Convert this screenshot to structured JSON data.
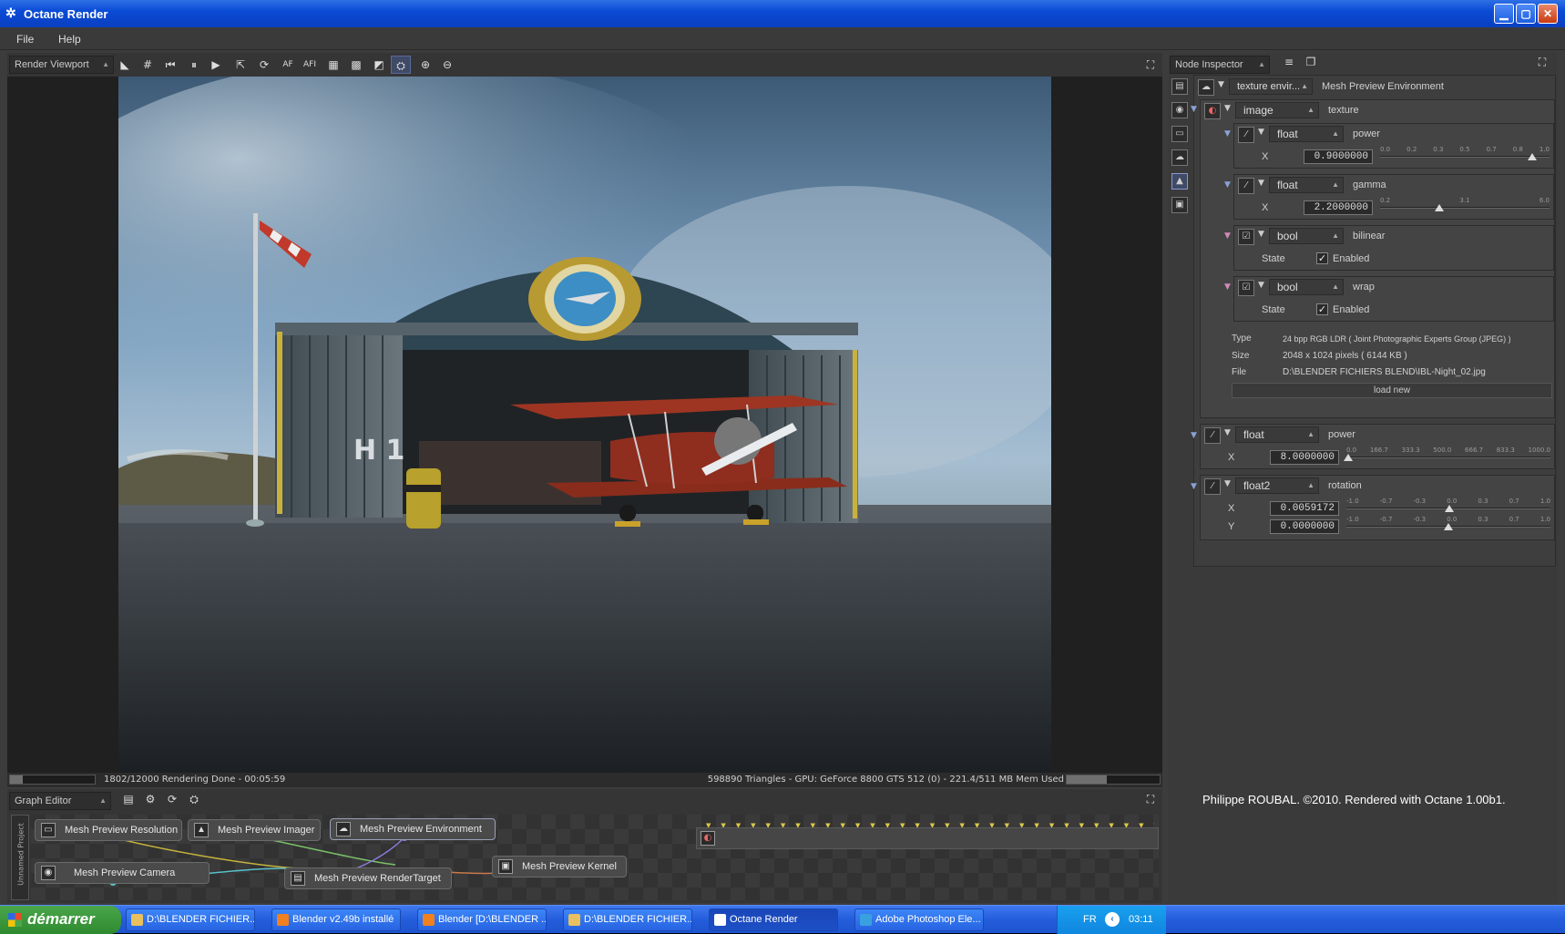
{
  "window": {
    "title": "Octane Render"
  },
  "menu": [
    "File",
    "Help"
  ],
  "viewport_toolbar": {
    "dropdown": "Render Viewport",
    "buttons": [
      {
        "name": "pick-focus-icon",
        "glyph": "◣"
      },
      {
        "name": "grid-icon",
        "glyph": "#"
      },
      {
        "name": "restart-icon",
        "glyph": "⏮"
      },
      {
        "name": "pause-icon",
        "glyph": "⏸"
      },
      {
        "name": "play-icon",
        "glyph": "▶"
      },
      {
        "name": "recenter-icon",
        "glyph": "⇱"
      },
      {
        "name": "reset-camera-icon",
        "glyph": "⟳"
      },
      {
        "name": "autofocus-icon",
        "glyph": "AF"
      },
      {
        "name": "autofocus-image-icon",
        "glyph": "AFI"
      },
      {
        "name": "region-icon",
        "glyph": "▦"
      },
      {
        "name": "checker-icon",
        "glyph": "▩"
      },
      {
        "name": "alpha-icon",
        "glyph": "◩"
      },
      {
        "name": "lock-view-icon",
        "glyph": "⛭"
      },
      {
        "name": "zoom-in-icon",
        "glyph": "⊕"
      },
      {
        "name": "zoom-out-icon",
        "glyph": "⊖"
      }
    ]
  },
  "status": {
    "left_text": "1802/12000 Rendering Done - 00:05:59",
    "right_text": "598890 Triangles - GPU: GeForce 8800 GTS 512 (0) - 221.4/511 MB Mem Used",
    "render_progress": 0.15,
    "memory_progress": 0.43
  },
  "render_image": {
    "sign_text": "H 1"
  },
  "graph_editor": {
    "dropdown": "Graph Editor",
    "side_label": "Unnamed Project",
    "nodes": [
      {
        "name": "graph-node-mesh-preview-resolution",
        "label": "Mesh Preview Resolution"
      },
      {
        "name": "graph-node-mesh-preview-imager",
        "label": "Mesh Preview Imager"
      },
      {
        "name": "graph-node-mesh-preview-environment",
        "label": "Mesh Preview Environment"
      },
      {
        "name": "graph-node-mesh-preview-camera",
        "label": "Mesh Preview Camera"
      },
      {
        "name": "graph-node-mesh-preview-rendertarget",
        "label": "Mesh Preview RenderTarget"
      },
      {
        "name": "graph-node-mesh-preview-kernel",
        "label": "Mesh Preview Kernel"
      }
    ]
  },
  "inspector": {
    "dropdown": "Node Inspector",
    "root": {
      "type": "texture envir...",
      "name": "Mesh Preview Environment"
    },
    "image": {
      "type": "image",
      "name": "texture"
    },
    "power_inner": {
      "type": "float",
      "name": "power",
      "axis": "X",
      "value": "0.9000000",
      "ticks": [
        "0.0",
        "0.2",
        "0.3",
        "0.5",
        "0.7",
        "0.8",
        "1.0"
      ],
      "fraction": 0.9
    },
    "gamma": {
      "type": "float",
      "name": "gamma",
      "axis": "X",
      "value": "2.2000000",
      "ticks": [
        "0.2",
        "3.1",
        "6.0"
      ],
      "fraction": 0.35
    },
    "bilinear": {
      "type": "bool",
      "name": "bilinear",
      "state_label": "State",
      "state_value": "Enabled"
    },
    "wrap": {
      "type": "bool",
      "name": "wrap",
      "state_label": "State",
      "state_value": "Enabled"
    },
    "info": [
      {
        "label": "Type",
        "value": "24 bpp RGB LDR ( Joint Photographic Experts Group (JPEG) )"
      },
      {
        "label": "Size",
        "value": "2048 x 1024 pixels ( 6144 KB )"
      },
      {
        "label": "File",
        "value": "D:\\BLENDER FICHIERS BLEND\\IBL-Night_02.jpg"
      }
    ],
    "load_new": "load new",
    "power_outer": {
      "type": "float",
      "name": "power",
      "axis": "X",
      "value": "8.0000000",
      "ticks": [
        "0.0",
        "166.7",
        "333.3",
        "500.0",
        "666.7",
        "833.3",
        "1000.0"
      ],
      "fraction": 0.008
    },
    "rotation": {
      "type": "float2",
      "name": "rotation",
      "x_axis": "X",
      "x_value": "0.0059172",
      "y_axis": "Y",
      "y_value": "0.0000000",
      "ticks": [
        "-1.0",
        "-0.7",
        "-0.3",
        "0.0",
        "0.3",
        "0.7",
        "1.0"
      ],
      "x_fraction": 0.503,
      "y_fraction": 0.5
    }
  },
  "credit": "Philippe ROUBAL. ©2010. Rendered with Octane 1.00b1.",
  "taskbar": {
    "start": "démarrer",
    "tasks": [
      {
        "label": "D:\\BLENDER FICHIER...",
        "icon_color": "#e8c060"
      },
      {
        "label": "Blender v2.49b installé",
        "icon_color": "#f08020"
      },
      {
        "label": "Blender [D:\\BLENDER ...",
        "icon_color": "#f08020"
      },
      {
        "label": "D:\\BLENDER FICHIER...",
        "icon_color": "#e8c060"
      },
      {
        "label": "Octane Render",
        "icon_color": "#ffffff"
      },
      {
        "label": "Adobe Photoshop Ele...",
        "icon_color": "#3aa0e0"
      }
    ],
    "lang": "FR",
    "clock": "03:11"
  }
}
